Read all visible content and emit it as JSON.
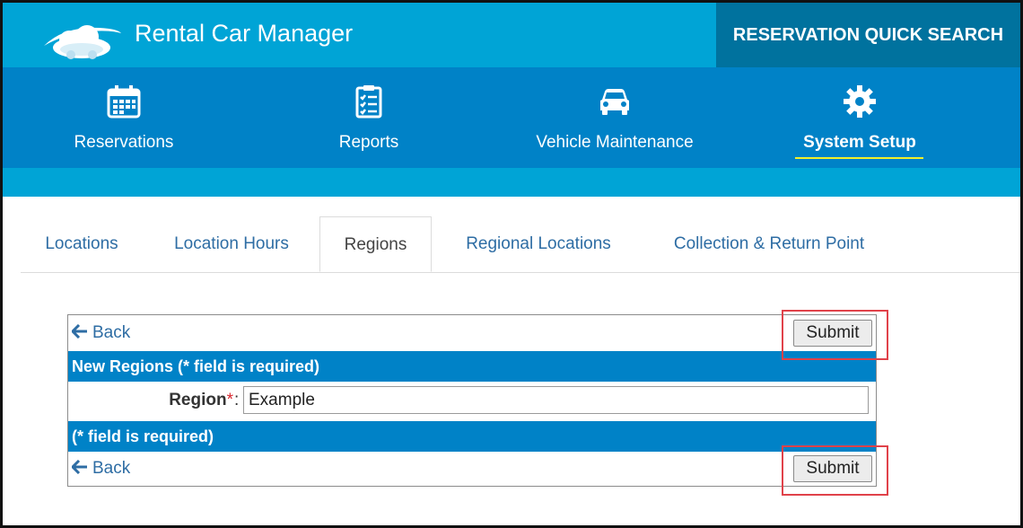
{
  "header": {
    "app_title": "Rental Car Manager",
    "quick_search_label": "RESERVATION QUICK SEARCH"
  },
  "nav": {
    "items": [
      {
        "label": "Reservations",
        "icon": "calendar-icon",
        "active": false
      },
      {
        "label": "Reports",
        "icon": "checklist-icon",
        "active": false
      },
      {
        "label": "Vehicle Maintenance",
        "icon": "car-icon",
        "active": false
      },
      {
        "label": "System Setup",
        "icon": "gear-icon",
        "active": true
      }
    ]
  },
  "tabs": [
    {
      "label": "Locations",
      "active": false
    },
    {
      "label": "Location Hours",
      "active": false
    },
    {
      "label": "Regions",
      "active": true
    },
    {
      "label": "Regional Locations",
      "active": false
    },
    {
      "label": "Collection & Return Point",
      "active": false
    }
  ],
  "form": {
    "back_label": "Back",
    "submit_label": "Submit",
    "section_title": "New Regions (* field is required)",
    "footer_note": "(* field is required)",
    "region_label": "Region",
    "required_mark": "*",
    "colon": ":",
    "region_value": "Example"
  },
  "colors": {
    "topbar": "#00a4d6",
    "navbar": "#0082c7",
    "quick_search_bg": "#00729e",
    "active_underline": "#f0f02a",
    "highlight_box": "#e0424a",
    "link": "#2e6da4"
  }
}
